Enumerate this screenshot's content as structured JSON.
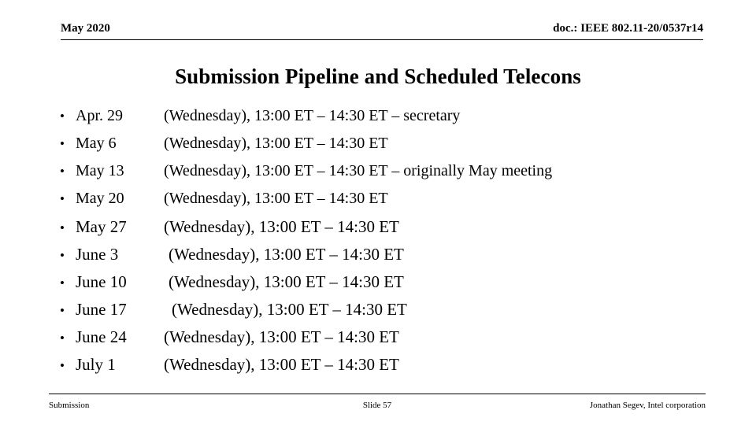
{
  "header": {
    "left": "May 2020",
    "right": "doc.: IEEE 802.11-20/0537r14"
  },
  "title": "Submission Pipeline and Scheduled Telecons",
  "bullet_mark": "•",
  "items": [
    {
      "date": "Apr. 29",
      "desc": "(Wednesday), 13:00 ET – 14:30 ET – secretary"
    },
    {
      "date": "May 6",
      "desc": "(Wednesday), 13:00 ET – 14:30 ET"
    },
    {
      "date": "May 13",
      "desc": "(Wednesday), 13:00 ET – 14:30 ET – originally May meeting"
    },
    {
      "date": "May 20",
      "desc": "(Wednesday), 13:00 ET – 14:30 ET"
    },
    {
      "date": "May 27",
      "desc": "(Wednesday), 13:00 ET – 14:30 ET"
    },
    {
      "date": "June 3",
      "desc": "(Wednesday), 13:00 ET – 14:30 ET"
    },
    {
      "date": "June 10",
      "desc": "(Wednesday), 13:00 ET – 14:30 ET"
    },
    {
      "date": "June 17",
      "desc": "(Wednesday), 13:00 ET – 14:30 ET"
    },
    {
      "date": "June 24",
      "desc": "(Wednesday), 13:00 ET – 14:30 ET"
    },
    {
      "date": "July 1",
      "desc": "(Wednesday), 13:00 ET – 14:30 ET"
    }
  ],
  "footer": {
    "left": "Submission",
    "center": "Slide 57",
    "right": "Jonathan Segev, Intel corporation"
  }
}
